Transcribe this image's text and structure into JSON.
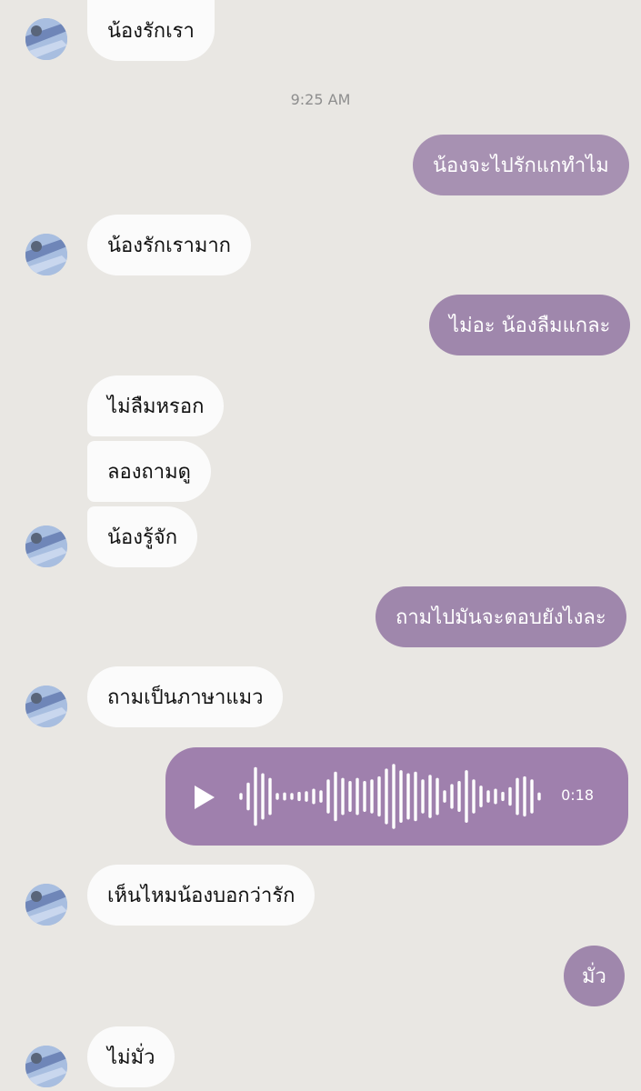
{
  "chat": {
    "timestamp": "9:25 AM",
    "messages": [
      {
        "text": "น้องรักเรา"
      },
      {
        "text": "น้องจะไปรักแกทำไม"
      },
      {
        "text": "น้องรักเรามาก"
      },
      {
        "text": "ไม่อะ น้องลืมแกละ"
      },
      {
        "text": "ไม่ลืมหรอก"
      },
      {
        "text": "ลองถามดู"
      },
      {
        "text": "น้องรู้จัก"
      },
      {
        "text": "ถามไปมันจะตอบยังไงละ"
      },
      {
        "text": "ถามเป็นภาษาแมว"
      },
      {
        "text": "เห็นไหมน้องบอกว่ารัก"
      },
      {
        "text": "มั่ว"
      },
      {
        "text": "ไม่มั่ว"
      }
    ],
    "voice_message": {
      "duration": "0:18",
      "color": "#9f80ad",
      "icon": "play-icon",
      "waveform_levels": [
        0.05,
        0.4,
        0.9,
        0.7,
        0.55,
        0.05,
        0.08,
        0.06,
        0.1,
        0.12,
        0.2,
        0.15,
        0.5,
        0.75,
        0.55,
        0.45,
        0.55,
        0.45,
        0.5,
        0.6,
        0.85,
        1.0,
        0.8,
        0.7,
        0.75,
        0.5,
        0.65,
        0.55,
        0.15,
        0.35,
        0.45,
        0.8,
        0.5,
        0.3,
        0.15,
        0.2,
        0.1,
        0.25,
        0.55,
        0.6,
        0.5,
        0.08
      ]
    }
  },
  "colors": {
    "background": "#e9e7e3",
    "incoming_bubble": "#fbfbfb",
    "outgoing_bubble": "#9f87ac"
  }
}
